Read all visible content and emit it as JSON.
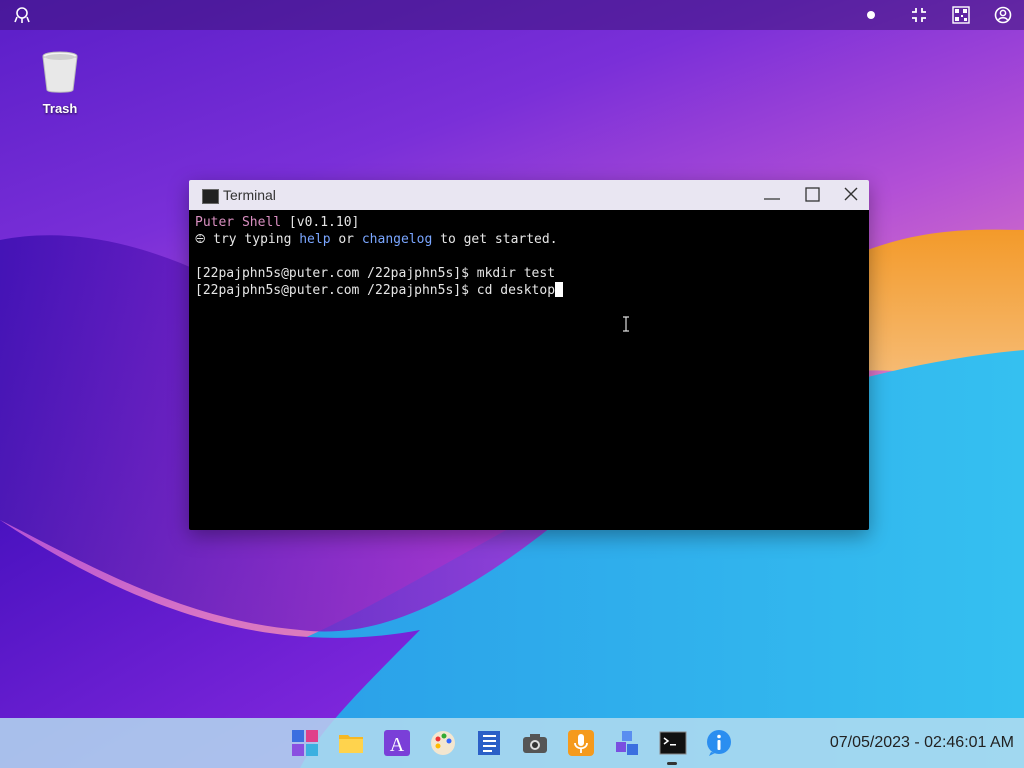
{
  "desktop": {
    "icons": [
      {
        "label": "Trash",
        "icon": "trash-icon"
      }
    ]
  },
  "topbar": {
    "icons": [
      "puter-logo-icon",
      "notification-dot-icon",
      "exit-fullscreen-icon",
      "qr-code-icon",
      "user-account-icon"
    ]
  },
  "terminal": {
    "title": "Terminal",
    "line1_name": "Puter Shell",
    "line1_version": " [v0.1.10]",
    "line2_pre": " try typing ",
    "line2_help": "help",
    "line2_or": " or ",
    "line2_changelog": "changelog",
    "line2_post": " to get started.",
    "cmd1": "[22pajphn5s@puter.com /22pajphn5s]$ mkdir test",
    "cmd2": "[22pajphn5s@puter.com /22pajphn5s]$ cd desktop"
  },
  "taskbar": {
    "apps": [
      "start-menu-icon",
      "files-icon",
      "editor-icon",
      "paint-icon",
      "notepad-icon",
      "camera-icon",
      "recorder-icon",
      "blocks-icon",
      "terminal-icon",
      "about-icon"
    ],
    "clock": "07/05/2023 - 02:46:01 AM"
  },
  "colors": {
    "shell_name": "#d98fc0",
    "keyword": "#7aa6ff",
    "terminal_bg": "#000000"
  }
}
